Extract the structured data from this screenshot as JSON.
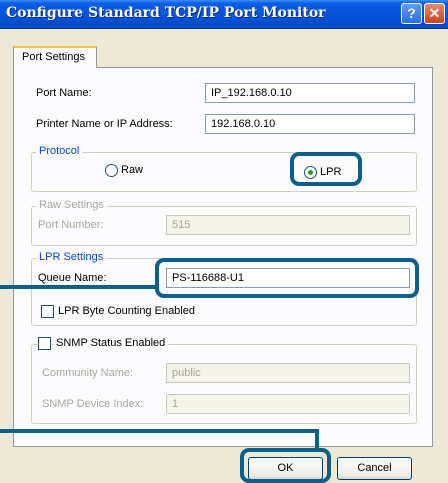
{
  "window": {
    "title": "Configure Standard TCP/IP Port Monitor",
    "help_glyph": "?",
    "close_glyph": "✕"
  },
  "tabs": {
    "port_settings": "Port Settings"
  },
  "port": {
    "name_label": "Port Name:",
    "name_value": "IP_192.168.0.10",
    "address_label": "Printer Name or IP Address:",
    "address_value": "192.168.0.10"
  },
  "protocol": {
    "title": "Protocol",
    "raw_label": "Raw",
    "lpr_label": "LPR",
    "selected": "LPR"
  },
  "raw_settings": {
    "title": "Raw Settings",
    "port_number_label": "Port Number:",
    "port_number_value": "515"
  },
  "lpr_settings": {
    "title": "LPR Settings",
    "queue_name_label": "Queue Name:",
    "queue_name_value": "PS-116688-U1",
    "byte_counting_label": "LPR Byte Counting Enabled",
    "byte_counting_checked": false
  },
  "snmp": {
    "enabled_label": "SNMP Status Enabled",
    "enabled_checked": false,
    "community_label": "Community Name:",
    "community_value": "public",
    "device_index_label": "SNMP Device Index:",
    "device_index_value": "1"
  },
  "buttons": {
    "ok": "OK",
    "cancel": "Cancel"
  },
  "colors": {
    "highlight": "#0b5f8a",
    "titlebar": "#0653d8"
  }
}
